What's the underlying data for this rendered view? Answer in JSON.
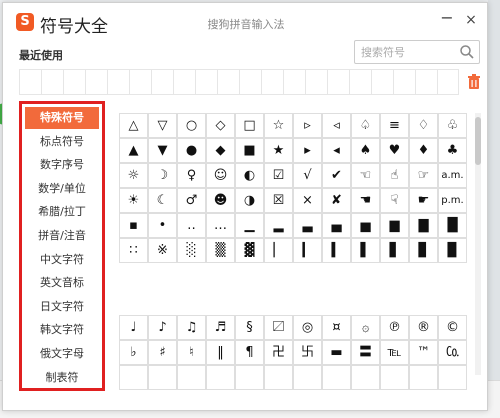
{
  "app": {
    "logo": "S",
    "title": "符号大全",
    "subtitle": "搜狗拼音输入法"
  },
  "window_controls": {
    "minimize": "−",
    "close": "×"
  },
  "recent": {
    "label": "最近使用",
    "cells": 20
  },
  "search": {
    "placeholder": "搜索符号",
    "value": ""
  },
  "colors": {
    "accent": "#f26a3b",
    "highlight_border": "#e02020",
    "brand": "#f15a24",
    "trash": "#f26a3b"
  },
  "sidebar": {
    "items": [
      {
        "label": "特殊符号",
        "active": true
      },
      {
        "label": "标点符号"
      },
      {
        "label": "数字序号"
      },
      {
        "label": "数学/单位"
      },
      {
        "label": "希腊/拉丁"
      },
      {
        "label": "拼音/注音"
      },
      {
        "label": "中文字符"
      },
      {
        "label": "英文音标"
      },
      {
        "label": "日文字符"
      },
      {
        "label": "韩文字符"
      },
      {
        "label": "俄文字母"
      },
      {
        "label": "制表符"
      }
    ]
  },
  "symbols": {
    "group1": [
      [
        "△",
        "▽",
        "○",
        "◇",
        "□",
        "☆",
        "▹",
        "◃",
        "♤",
        "≡",
        "♢",
        "♧"
      ],
      [
        "▲",
        "▼",
        "●",
        "◆",
        "■",
        "★",
        "▸",
        "◂",
        "♠",
        "♥",
        "♦",
        "♣"
      ],
      [
        "☼",
        "☽",
        "♀",
        "☺",
        "◐",
        "☑",
        "√",
        "✔",
        "☜",
        "☝",
        "☞",
        "a.m."
      ],
      [
        "☀",
        "☾",
        "♂",
        "☻",
        "◑",
        "☒",
        "×",
        "✘",
        "☚",
        "☟",
        "☛",
        "p.m."
      ],
      [
        "▪",
        "•",
        "‥",
        "…",
        "▁",
        "▂",
        "▃",
        "▄",
        "▅",
        "▆",
        "▇",
        "█"
      ],
      [
        "∷",
        "※",
        "░",
        "▒",
        "▓",
        "▏",
        "▎",
        "▍",
        "▌",
        "▋",
        "▊",
        "▉"
      ]
    ],
    "group2": [
      [
        "♩",
        "♪",
        "♫",
        "♬",
        "§",
        "〼",
        "◎",
        "¤",
        "۞",
        "℗",
        "®",
        "©"
      ],
      [
        "♭",
        "♯",
        "♮",
        "‖",
        "¶",
        "卍",
        "卐",
        "▬",
        "〓",
        "℡",
        "™",
        "㏇"
      ],
      [
        "",
        "",
        "",
        "",
        "",
        "",
        "",
        "",
        "",
        "",
        "",
        ""
      ]
    ]
  }
}
